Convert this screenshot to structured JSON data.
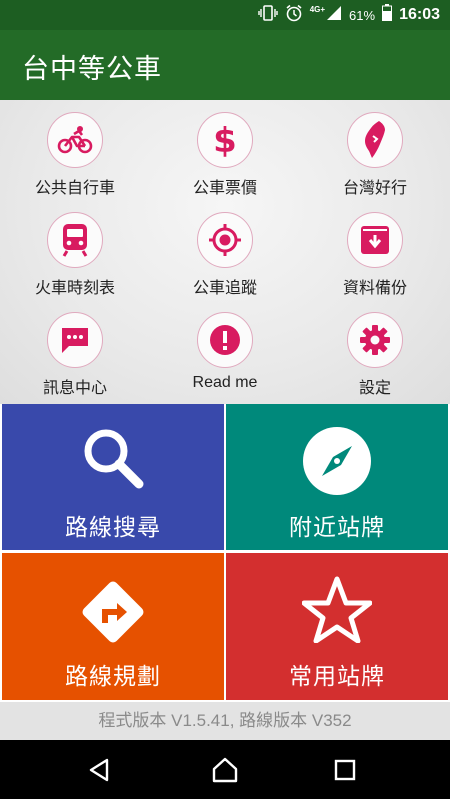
{
  "status_bar": {
    "network": "4G+",
    "battery": "61%",
    "time": "16:03"
  },
  "app": {
    "title": "台中等公車"
  },
  "menu": {
    "items": [
      {
        "label": "公共自行車",
        "icon": "bicycle-icon"
      },
      {
        "label": "公車票價",
        "icon": "dollar-icon"
      },
      {
        "label": "台灣好行",
        "icon": "taiwan-map-icon"
      },
      {
        "label": "火車時刻表",
        "icon": "train-icon"
      },
      {
        "label": "公車追蹤",
        "icon": "gps-target-icon"
      },
      {
        "label": "資料備份",
        "icon": "archive-download-icon"
      },
      {
        "label": "訊息中心",
        "icon": "message-icon"
      },
      {
        "label": "Read me",
        "icon": "alert-icon"
      },
      {
        "label": "設定",
        "icon": "gear-icon"
      }
    ]
  },
  "tiles": [
    {
      "label": "路線搜尋",
      "icon": "search-icon",
      "color": "#3949ab"
    },
    {
      "label": "附近站牌",
      "icon": "compass-icon",
      "color": "#00897b"
    },
    {
      "label": "路線規劃",
      "icon": "directions-icon",
      "color": "#e65100"
    },
    {
      "label": "常用站牌",
      "icon": "star-icon",
      "color": "#d32f2f"
    }
  ],
  "footer": {
    "version_text": "程式版本 V1.5.41, 路線版本 V352"
  },
  "colors": {
    "accent": "#d81b60",
    "app_bar": "#236b27",
    "status_bar": "#1d5e22"
  }
}
